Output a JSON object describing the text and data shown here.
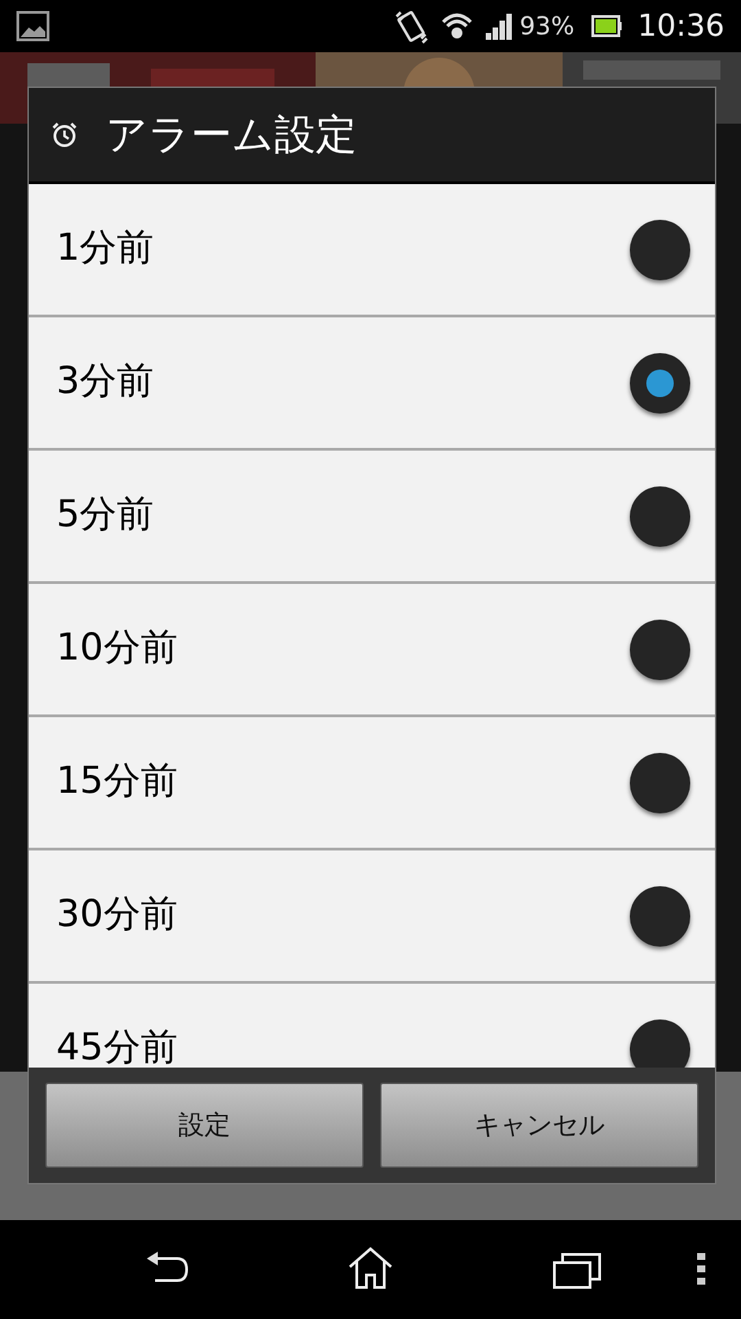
{
  "status_bar": {
    "battery": "93%",
    "time": "10:36"
  },
  "dialog": {
    "title": "アラーム設定",
    "options": [
      {
        "label": "1分前",
        "selected": false
      },
      {
        "label": "3分前",
        "selected": true
      },
      {
        "label": "5分前",
        "selected": false
      },
      {
        "label": "10分前",
        "selected": false
      },
      {
        "label": "15分前",
        "selected": false
      },
      {
        "label": "30分前",
        "selected": false
      },
      {
        "label": "45分前",
        "selected": false
      }
    ],
    "buttons": [
      "設定",
      "キャンセル"
    ]
  }
}
